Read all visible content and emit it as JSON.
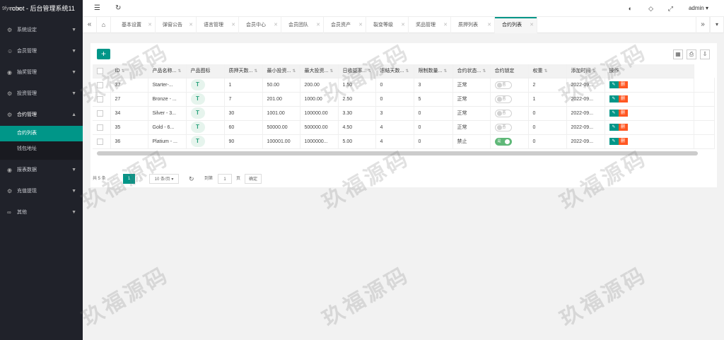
{
  "app": {
    "title": "robot - 后台管理系统11",
    "watermark_top": "9fym.me"
  },
  "sidebar": {
    "items": [
      {
        "label": "系统设定",
        "icon": "gear-icon"
      },
      {
        "label": "会员管理",
        "icon": "user-icon"
      },
      {
        "label": "抽奖管理",
        "icon": "circle-icon"
      },
      {
        "label": "投资管理",
        "icon": "gear-icon"
      },
      {
        "label": "合约管理",
        "icon": "gear-icon"
      },
      {
        "label": "报表数据",
        "icon": "circle-icon"
      },
      {
        "label": "充值提现",
        "icon": "gear-icon"
      },
      {
        "label": "其他",
        "icon": "link-icon"
      }
    ],
    "sub_items": [
      {
        "label": "合约列表"
      },
      {
        "label": "钱包地址"
      }
    ]
  },
  "header": {
    "user": "admin"
  },
  "tabs": [
    {
      "label": "基本设置"
    },
    {
      "label": "弹窗公告"
    },
    {
      "label": "语言管理"
    },
    {
      "label": "会员中心"
    },
    {
      "label": "会员团队"
    },
    {
      "label": "会员资产"
    },
    {
      "label": "裂变等级"
    },
    {
      "label": "奖品管理"
    },
    {
      "label": "质押列表"
    },
    {
      "label": "合约列表"
    }
  ],
  "table": {
    "add_label": "+",
    "columns": [
      "ID",
      "产品名称...",
      "产品图标",
      "质押天数...",
      "最小投资...",
      "最大投资...",
      "日收益率...",
      "冻结天数...",
      "限制数量...",
      "合约状态...",
      "合约锁定",
      "权重",
      "添加时间",
      "操作"
    ],
    "rows": [
      {
        "id": "37",
        "name": "Starter-...",
        "days": "1",
        "min": "50.00",
        "max": "200.00",
        "rate": "1.50",
        "freeze": "0",
        "limit": "3",
        "status": "正常",
        "lock": "否",
        "lock_on": false,
        "weight": "2",
        "time": "2022-09..."
      },
      {
        "id": "27",
        "name": "Bronze - ...",
        "days": "7",
        "min": "201.00",
        "max": "1000.00",
        "rate": "2.50",
        "freeze": "0",
        "limit": "5",
        "status": "正常",
        "lock": "否",
        "lock_on": false,
        "weight": "1",
        "time": "2022-09..."
      },
      {
        "id": "34",
        "name": "Silver - 3...",
        "days": "30",
        "min": "1001.00",
        "max": "100000.00",
        "rate": "3.30",
        "freeze": "3",
        "limit": "0",
        "status": "正常",
        "lock": "否",
        "lock_on": false,
        "weight": "0",
        "time": "2022-09..."
      },
      {
        "id": "35",
        "name": "Gold - 6...",
        "days": "60",
        "min": "50000.00",
        "max": "500000.00",
        "rate": "4.50",
        "freeze": "4",
        "limit": "0",
        "status": "正常",
        "lock": "否",
        "lock_on": false,
        "weight": "0",
        "time": "2022-09..."
      },
      {
        "id": "36",
        "name": "Platium - ...",
        "days": "90",
        "min": "100001.00",
        "max": "1000000...",
        "rate": "5.00",
        "freeze": "4",
        "limit": "0",
        "status": "禁止",
        "lock": "是",
        "lock_on": true,
        "weight": "0",
        "time": "2022-09..."
      }
    ],
    "icon_glyph": "T",
    "op_edit": "✎",
    "op_del": "删"
  },
  "pager": {
    "total": "共 5 条",
    "current": "1",
    "page_size": "10 条/页",
    "goto_label": "到第",
    "goto_value": "1",
    "page_unit": "页",
    "confirm": "确定"
  },
  "watermark": "玖福源码"
}
